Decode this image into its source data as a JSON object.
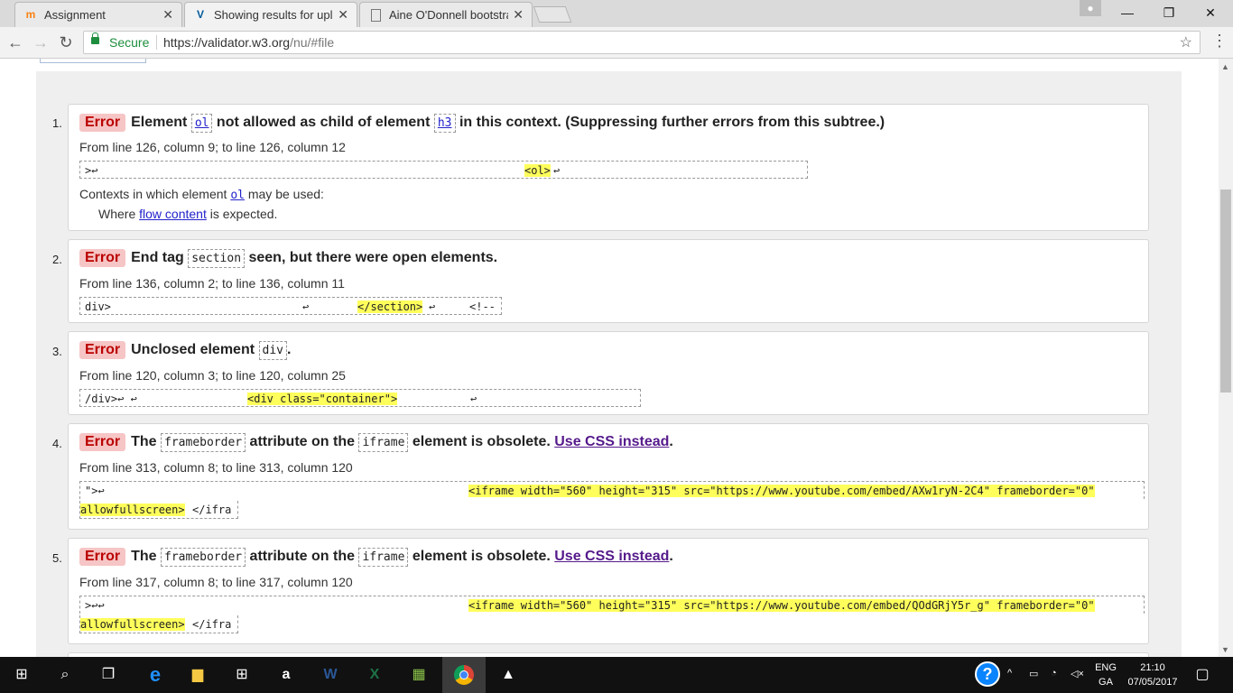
{
  "browser": {
    "tabs": [
      {
        "title": "Assignment",
        "favicon": "m"
      },
      {
        "title": "Showing results for uplo",
        "favicon": "V"
      },
      {
        "title": "Aine O'Donnell bootstra",
        "favicon": "doc"
      }
    ],
    "close_glyph": "✕",
    "window": {
      "minimize": "—",
      "restore": "❐",
      "close": "✕"
    },
    "address": {
      "secure_label": "Secure",
      "origin": "https://validator.w3.org",
      "path": "/nu/#file"
    }
  },
  "messages": [
    {
      "number": "1.",
      "type": "Error",
      "parts": [
        "Element ",
        "ol",
        " not allowed as child of element ",
        "h3",
        " in this context. (Suppressing further errors from this subtree.)"
      ],
      "location": "From line 126, column 9; to line 126, column 12",
      "extract": [
        ">↩",
        "<ol>",
        "↩"
      ],
      "contexts_label": "Contexts in which element ",
      "contexts_elem": "ol",
      "contexts_tail": " may be used:",
      "where_label": "Where ",
      "where_link": "flow content",
      "where_tail": " is expected."
    },
    {
      "number": "2.",
      "type": "Error",
      "parts": [
        "End tag ",
        "section",
        " seen, but there were open elements."
      ],
      "location": "From line 136, column 2; to line 136, column 11",
      "extract": [
        "div>",
        "↩",
        "</section>",
        "↩",
        "<!--"
      ]
    },
    {
      "number": "3.",
      "type": "Error",
      "parts": [
        "Unclosed element ",
        "div",
        "."
      ],
      "location": "From line 120, column 3; to line 120, column 25",
      "extract": [
        "/div>↩ ↩",
        "<div class=\"container\">",
        "↩"
      ]
    },
    {
      "number": "4.",
      "type": "Error",
      "parts": [
        "The ",
        "frameborder",
        " attribute on the ",
        "iframe",
        " element is obsolete. ",
        "Use CSS instead",
        "."
      ],
      "location": "From line 313, column 8; to line 313, column 120",
      "extract": [
        "\">↩",
        "<iframe width=\"560\" height=\"315\" src=\"https://www.youtube.com/embed/AXw1ryN-2C4\" frameborder=\"0\"",
        "allowfullscreen>",
        "</ifra"
      ]
    },
    {
      "number": "5.",
      "type": "Error",
      "parts": [
        "The ",
        "frameborder",
        " attribute on the ",
        "iframe",
        " element is obsolete. ",
        "Use CSS instead",
        "."
      ],
      "location": "From line 317, column 8; to line 317, column 120",
      "extract": [
        ">↩↩",
        "<iframe width=\"560\" height=\"315\" src=\"https://www.youtube.com/embed/QOdGRjY5r_g\" frameborder=\"0\"",
        "allowfullscreen>",
        "</ifra"
      ]
    }
  ],
  "taskbar": {
    "lang": "ENG",
    "lang2": "GA",
    "time": "21:10",
    "date": "07/05/2017",
    "help": "?"
  },
  "colors": {
    "error_badge_bg": "#f6c5c5",
    "error_badge_text": "#bb0000",
    "highlight": "#ffff5c",
    "secure": "#1e8e3e"
  }
}
